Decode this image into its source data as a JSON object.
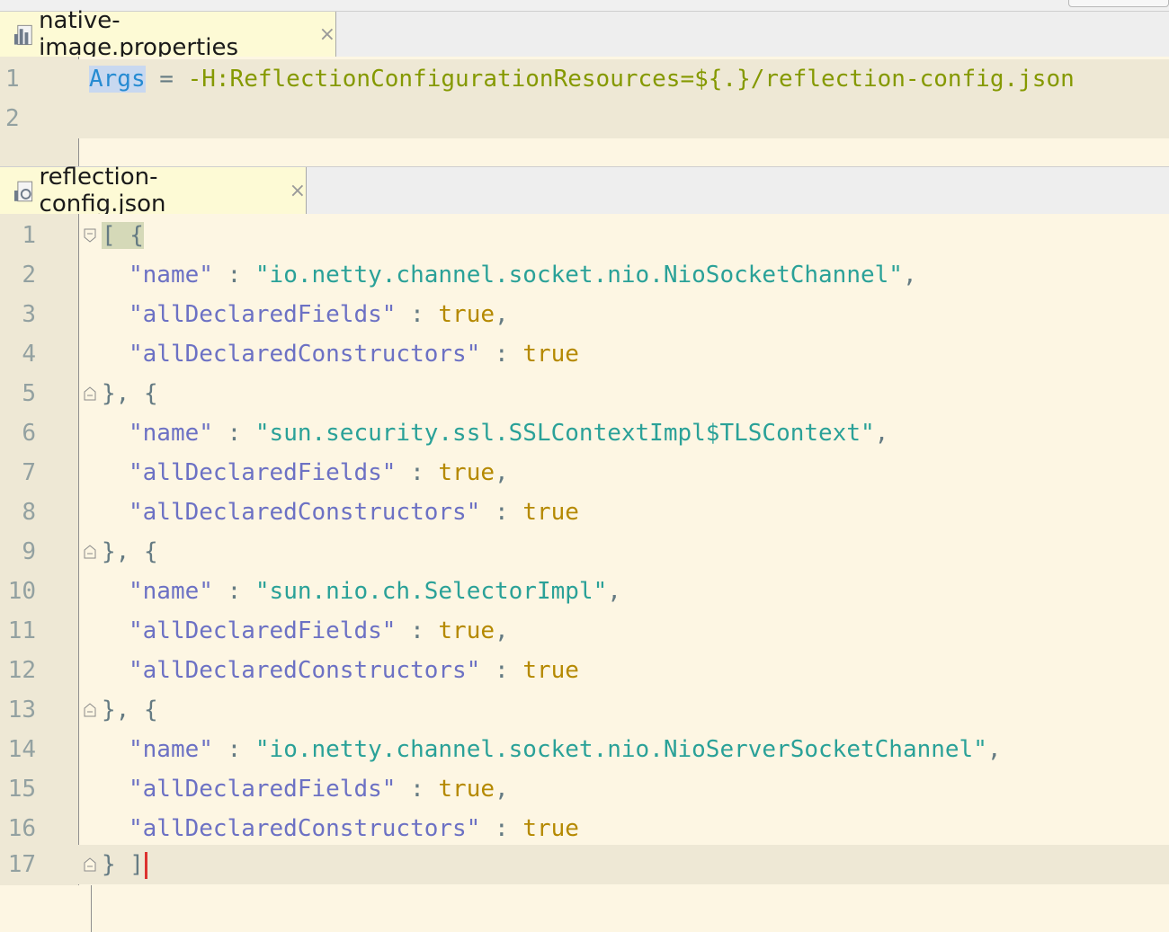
{
  "tabs": [
    {
      "label": "native-image.properties",
      "close": "×"
    },
    {
      "label": "reflection-config.json",
      "close": "×"
    }
  ],
  "properties_editor": {
    "line_numbers": [
      "1",
      "2"
    ],
    "line1": {
      "key": "Args",
      "eq": " = ",
      "value": "-H:ReflectionConfigurationResources=${.}/reflection-config.json"
    }
  },
  "json_editor": {
    "line_numbers": [
      "1",
      "2",
      "3",
      "4",
      "5",
      "6",
      "7",
      "8",
      "9",
      "10",
      "11",
      "12",
      "13",
      "14",
      "15",
      "16",
      "17"
    ],
    "open_brace": "[ {",
    "separator": "}, {",
    "close": "} ]",
    "name_key": "\"name\"",
    "fields_key": "\"allDeclaredFields\"",
    "constructors_key": "\"allDeclaredConstructors\"",
    "colon": " : ",
    "comma": ",",
    "true_val": "true",
    "entries": [
      {
        "name": "\"io.netty.channel.socket.nio.NioSocketChannel\""
      },
      {
        "name": "\"sun.security.ssl.SSLContextImpl$TLSContext\""
      },
      {
        "name": "\"sun.nio.ch.SelectorImpl\""
      },
      {
        "name": "\"io.netty.channel.socket.nio.NioServerSocketChannel\""
      }
    ]
  },
  "icons": {
    "file": "properties-file-icon",
    "json": "json-file-icon",
    "close": "close-icon",
    "fold": "fold-marker-icon"
  },
  "colors": {
    "background": "#fdf6e3",
    "keyword": "#268bd2",
    "string": "#2aa198",
    "json_key": "#6c71c4",
    "boolean": "#b58900",
    "value": "#859900"
  }
}
